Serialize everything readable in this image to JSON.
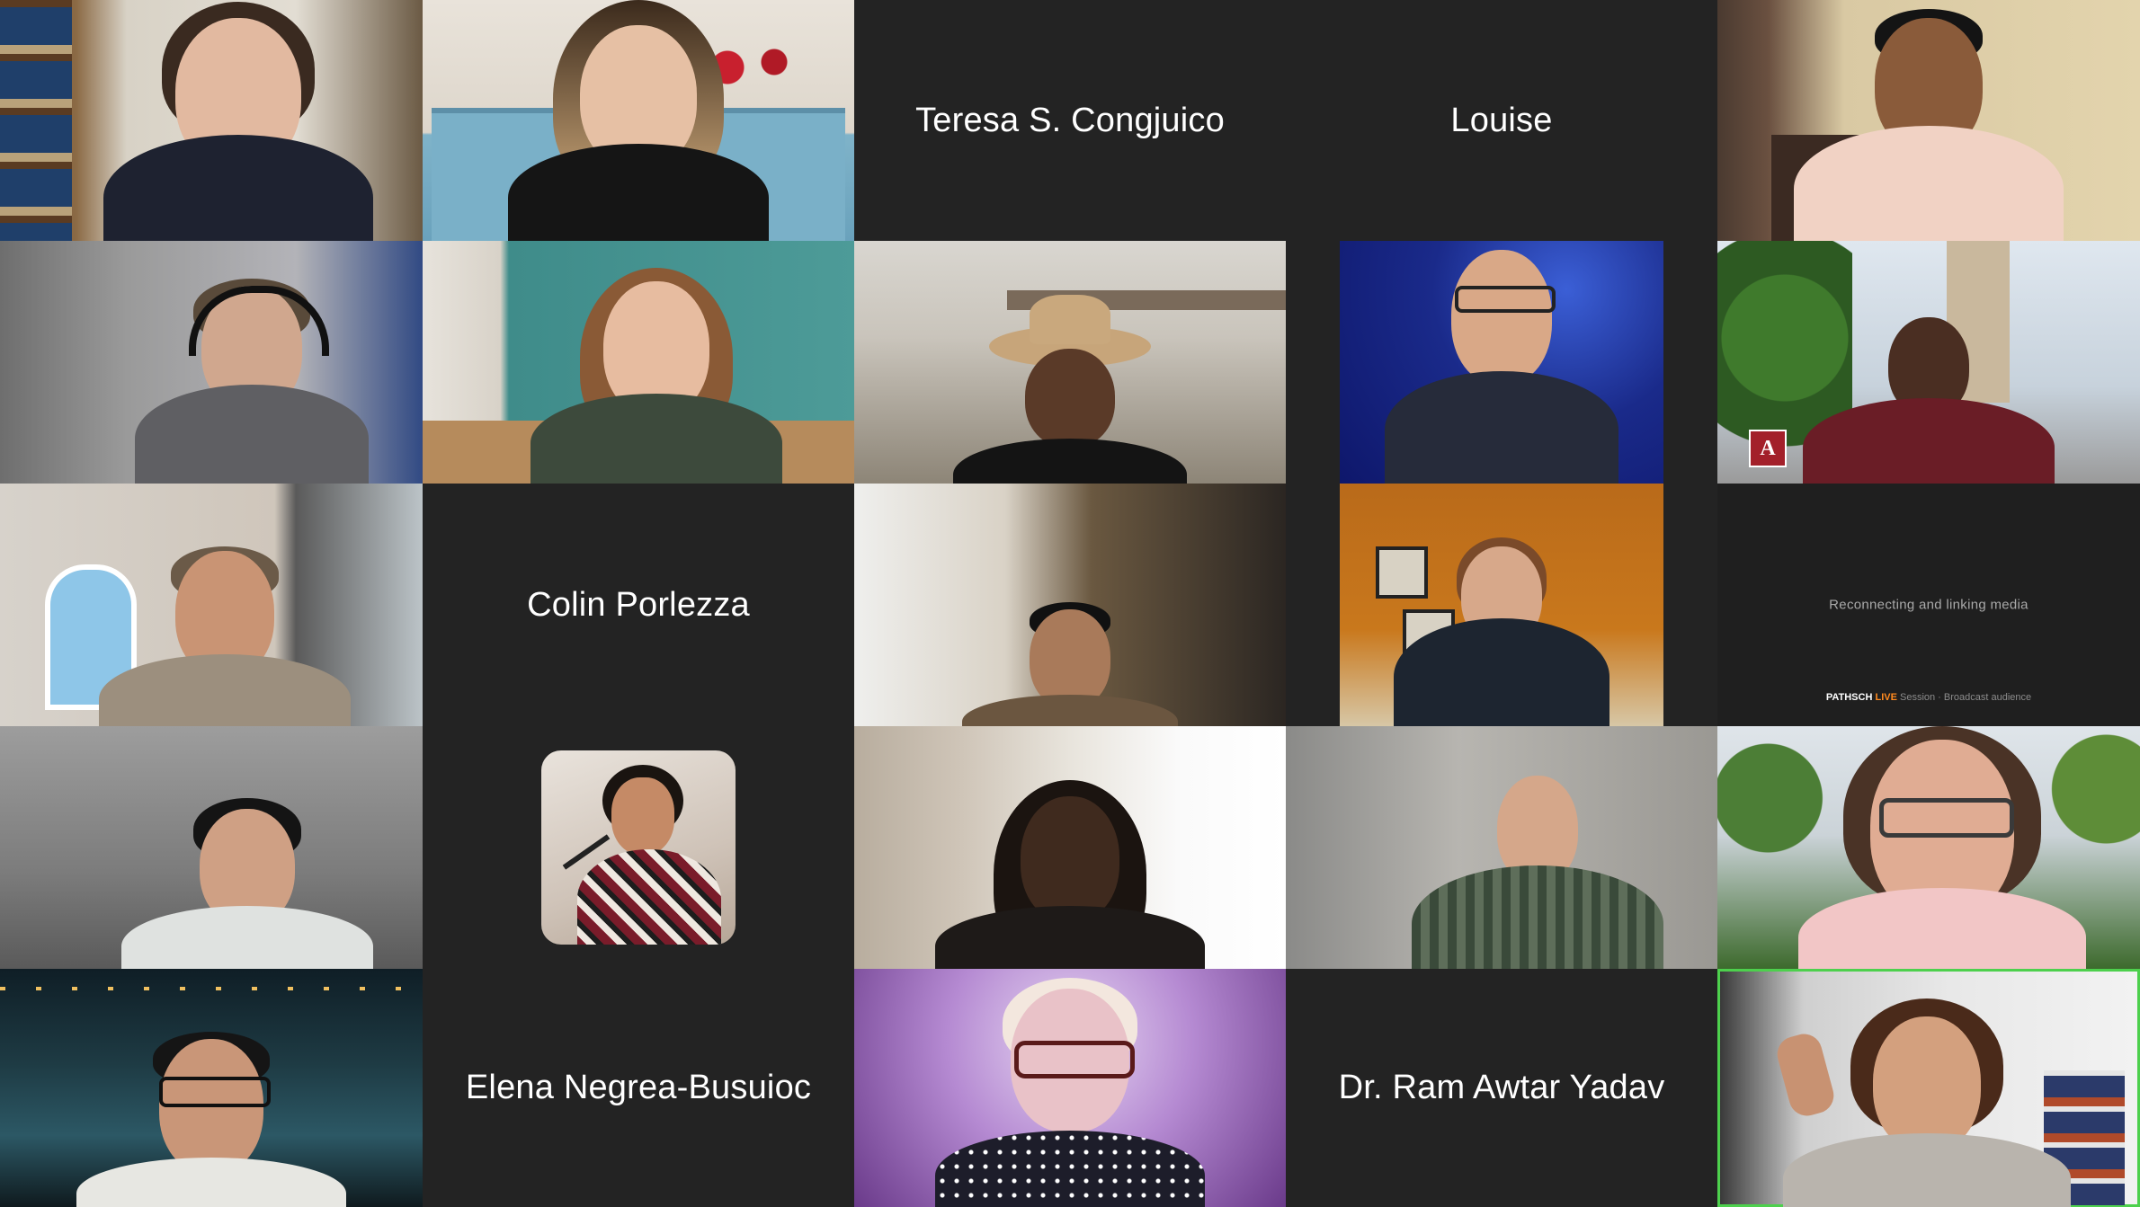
{
  "meeting": {
    "name_tiles": {
      "teresa": "Teresa S. Congjuico",
      "louise": "Louise",
      "colin": "Colin Porlezza",
      "elena": "Elena Negrea-Busuioc",
      "ram": "Dr. Ram Awtar Yadav"
    },
    "reconnecting": {
      "status": "Reconnecting and linking media",
      "footer_brand": "PATHSCH",
      "footer_badge": "LIVE",
      "footer_caption": "Session · Broadcast audience"
    },
    "colors": {
      "background": "#1a1a1a",
      "tile": "#232323",
      "active_speaker_border": "#4dd04d",
      "name_text": "#ffffff"
    },
    "icons": {
      "university_flag": "letter-a-flag-icon"
    },
    "active_speaker": "bottom-right tile"
  }
}
